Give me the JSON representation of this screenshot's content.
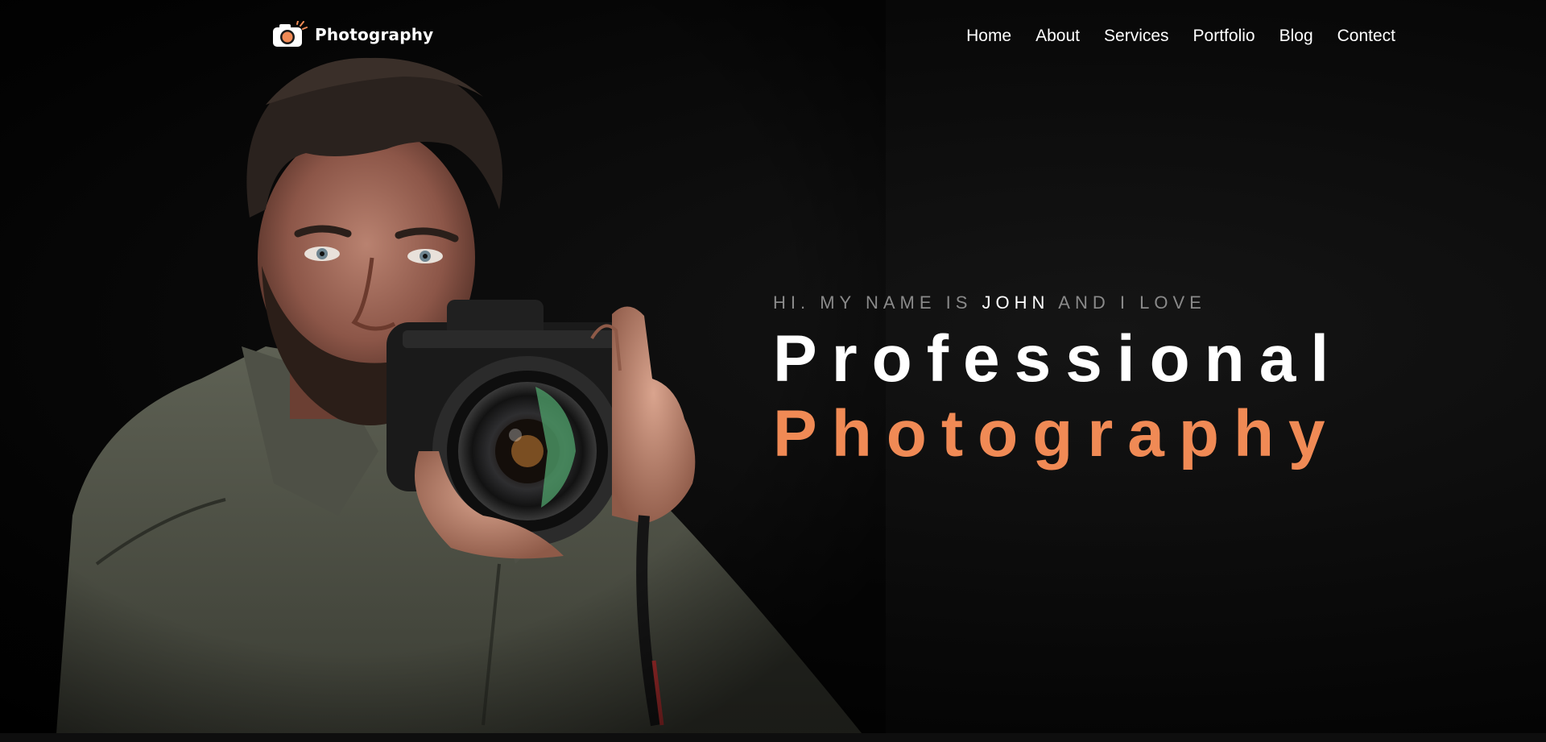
{
  "brand": {
    "logo_icon": "camera-icon",
    "name": "Photography",
    "accent_color": "#f08a55"
  },
  "nav": {
    "items": [
      {
        "label": "Home"
      },
      {
        "label": "About"
      },
      {
        "label": "Services"
      },
      {
        "label": "Portfolio"
      },
      {
        "label": "Blog"
      },
      {
        "label": "Contect"
      }
    ]
  },
  "hero": {
    "intro_before": "HI. MY NAME IS ",
    "intro_name": "JOHN",
    "intro_after": " AND I LOVE",
    "headline_line1": "Professional",
    "headline_line2": "Photography",
    "image": "photographer-holding-camera"
  }
}
